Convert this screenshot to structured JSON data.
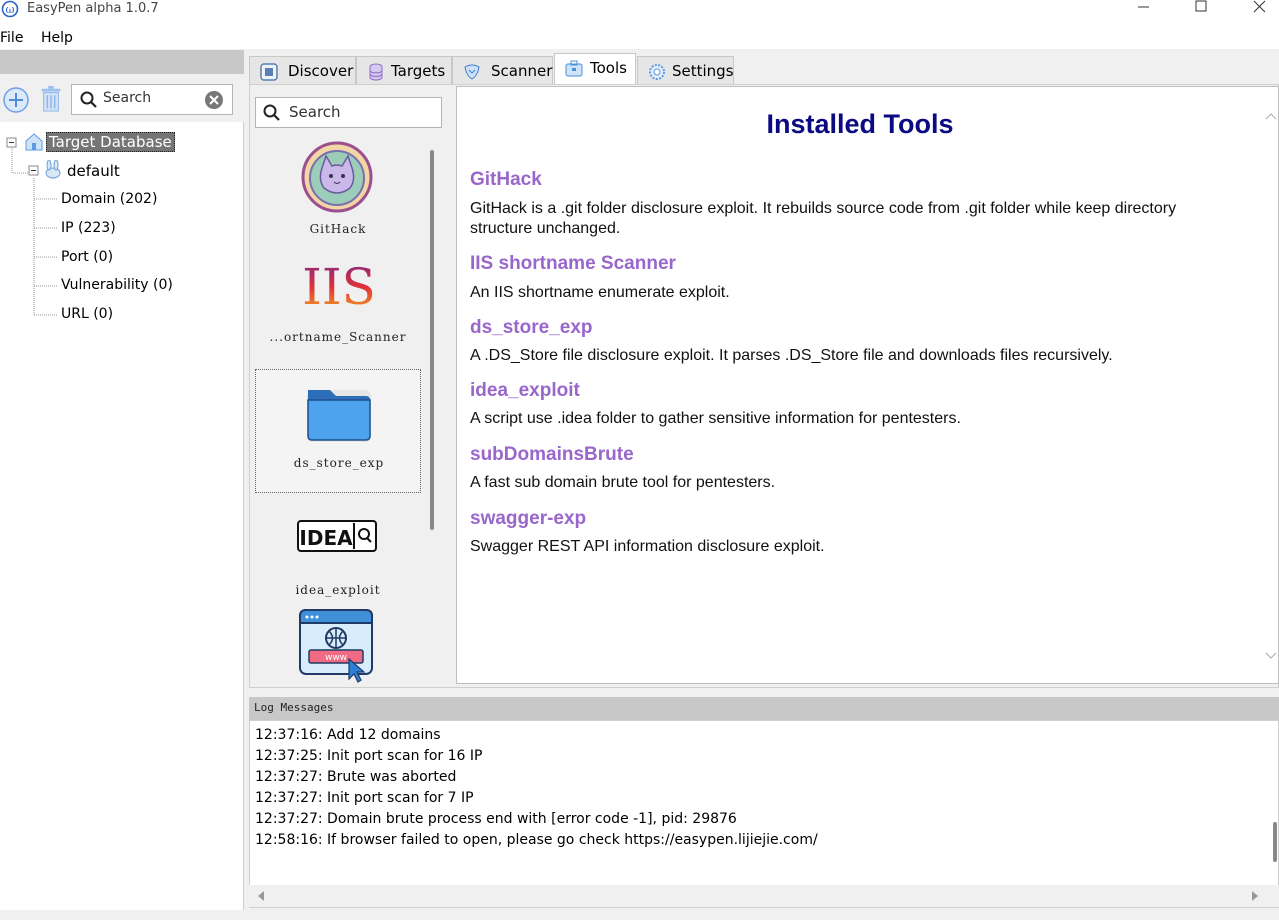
{
  "window": {
    "title": "EasyPen alpha 1.0.7"
  },
  "menu": {
    "file": "File",
    "help": "Help"
  },
  "left": {
    "search_label": "Search",
    "tree": {
      "root": "Target Database",
      "project": "default",
      "items": [
        "Domain (202)",
        "IP (223)",
        "Port (0)",
        "Vulnerability (0)",
        "URL (0)"
      ]
    }
  },
  "tabs": [
    {
      "label": "Discover",
      "icon": "discover-icon"
    },
    {
      "label": "Targets",
      "icon": "database-icon"
    },
    {
      "label": "Scanner",
      "icon": "shield-icon"
    },
    {
      "label": "Tools",
      "icon": "toolbox-icon",
      "active": true
    },
    {
      "label": "Settings",
      "icon": "gear-icon"
    }
  ],
  "tools_panel": {
    "search_label": "Search",
    "list": [
      {
        "name": "GitHack",
        "icon": "cat-avatar-icon"
      },
      {
        "name": "...ortname_Scanner",
        "icon": "iis-logo-icon",
        "logo_text": "IIS"
      },
      {
        "name": "ds_store_exp",
        "icon": "folder-icon",
        "selected": true
      },
      {
        "name": "idea_exploit",
        "icon": "idea-logo-icon",
        "logo_text": "IDEA"
      },
      {
        "name": "",
        "icon": "www-browser-icon",
        "logo_text": "www"
      }
    ]
  },
  "detail": {
    "heading": "Installed Tools",
    "tools": [
      {
        "name": "GitHack",
        "desc": "GitHack is a .git folder disclosure exploit. It rebuilds source code from .git folder while keep directory structure unchanged."
      },
      {
        "name": "IIS shortname Scanner",
        "desc": "An IIS shortname enumerate exploit."
      },
      {
        "name": "ds_store_exp",
        "desc": "A .DS_Store file disclosure exploit. It parses .DS_Store file and downloads files recursively."
      },
      {
        "name": "idea_exploit",
        "desc": "A script use .idea folder to gather sensitive information for pentesters."
      },
      {
        "name": "subDomainsBrute",
        "desc": "A fast sub domain brute tool for pentesters."
      },
      {
        "name": "swagger-exp",
        "desc": "Swagger REST API information disclosure exploit."
      }
    ]
  },
  "log": {
    "title": "Log Messages",
    "lines": [
      "12:37:16: Add 12 domains",
      "12:37:25: Init port scan for 16 IP",
      "12:37:27: Brute was aborted",
      "12:37:27: Init port scan for 7 IP",
      "12:37:27: Domain brute process end with [error code -1], pid: 29876",
      "12:58:16: If browser failed to open, please go check https://easypen.lijiejie.com/"
    ]
  },
  "colors": {
    "heading": "#0a0a82",
    "tool_name": "#9966cc",
    "selection": "#757575"
  }
}
